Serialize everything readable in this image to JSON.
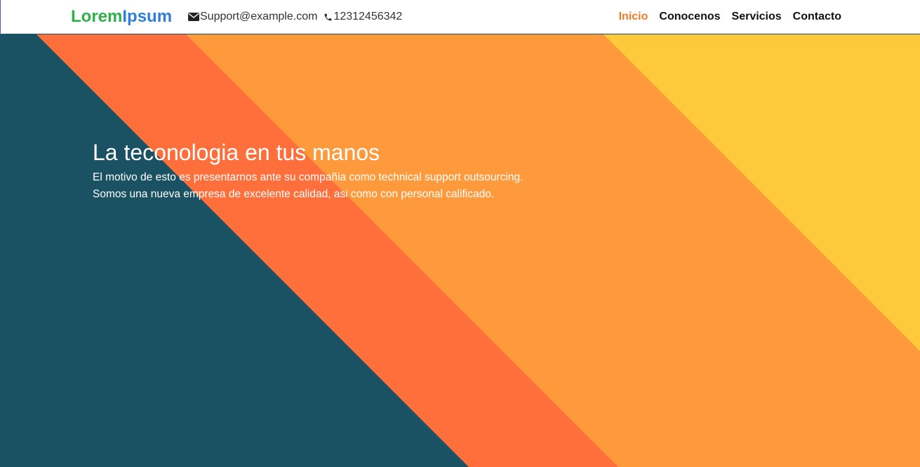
{
  "header": {
    "brand_part1": "Lorem",
    "brand_part2": "Ipsum",
    "email": "Support@example.com",
    "phone": "12312456342",
    "email_icon": "envelope-icon",
    "phone_icon": "phone-icon"
  },
  "nav": {
    "items": [
      {
        "label": "Inicio",
        "active": true
      },
      {
        "label": "Conocenos",
        "active": false
      },
      {
        "label": "Servicios",
        "active": false
      },
      {
        "label": "Contacto",
        "active": false
      }
    ]
  },
  "hero": {
    "title": "La teconologia en tus manos",
    "text": "El motivo de esto es presentarnos ante su compañia como technical support outsourcing. Somos una nueva empresa de excelente calidad, asi como con personal calificado."
  },
  "colors": {
    "brand_green": "#2eb14a",
    "brand_blue": "#2f7fd8",
    "active_nav": "#f07c2a",
    "stripe_teal": "#1a5263",
    "stripe_red_orange": "#ff6f3c",
    "stripe_orange": "#ff9a3c",
    "stripe_yellow": "#ffc93c"
  }
}
